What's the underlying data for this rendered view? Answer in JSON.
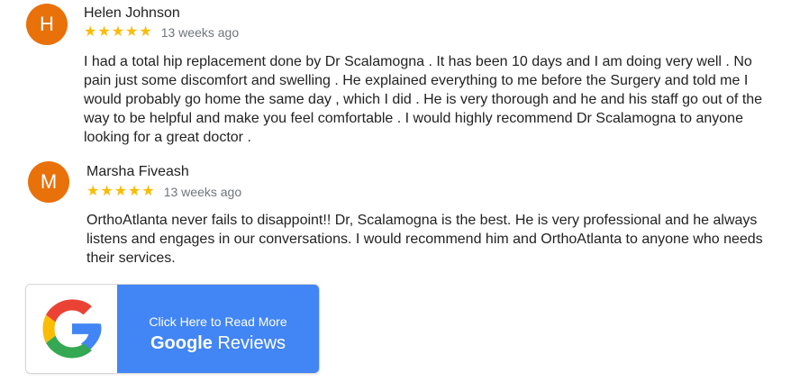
{
  "reviews": [
    {
      "avatar_letter": "H",
      "name": "Helen Johnson",
      "rating": 5,
      "stars": "★★★★★",
      "time": "13 weeks ago",
      "text": "I had a total hip replacement done by Dr Scalamogna . It has been 10 days and I am doing very well . No pain just some discomfort and swelling . He explained everything to me before the Surgery and told me I would probably go home the same day , which I did . He is very thorough and he and his staff go out of the way to be helpful and make you feel comfortable . I would highly recommend Dr Scalamogna to anyone looking for a great doctor ."
    },
    {
      "avatar_letter": "M",
      "name": "Marsha Fiveash",
      "rating": 5,
      "stars": "★★★★★",
      "time": "13 weeks ago",
      "text": "OrthoAtlanta never fails to disappoint!! Dr, Scalamogna is the best. He is very professional and he always listens and engages in our conversations. I would recommend him and OrthoAtlanta to anyone who needs their services."
    }
  ],
  "google_button": {
    "line1": "Click Here to Read More",
    "brand": "Google",
    "reviews_label": "Reviews",
    "icon": "google-g-logo-icon"
  },
  "colors": {
    "avatar": "#e8710a",
    "star": "#fbbc05",
    "button_blue": "#4285f4",
    "google_blue": "#4285f4",
    "google_red": "#ea4335",
    "google_yellow": "#fbbc05",
    "google_green": "#34a853"
  }
}
